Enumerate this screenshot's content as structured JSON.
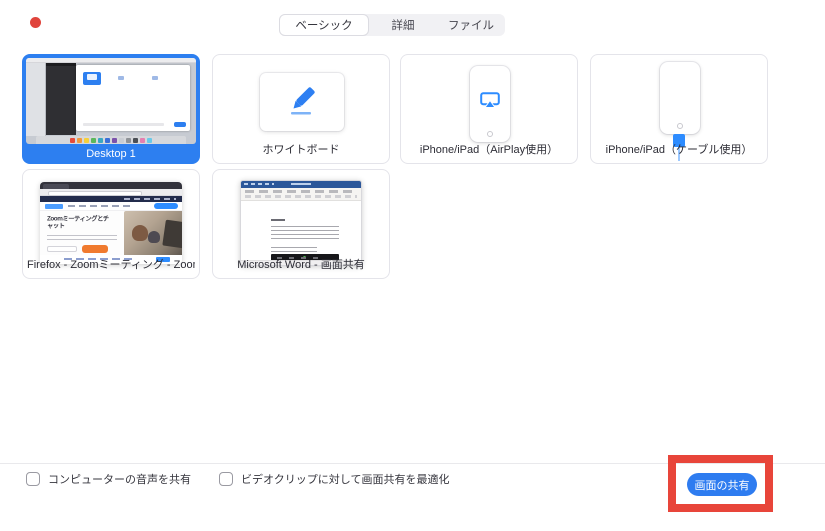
{
  "window": {
    "app": "Zoom 画面共有ウィンドウ"
  },
  "tabs": [
    {
      "label": "ベーシック",
      "selected": true
    },
    {
      "label": "詳細",
      "selected": false
    },
    {
      "label": "ファイル",
      "selected": false
    }
  ],
  "tiles": [
    {
      "label": "Desktop 1",
      "type": "desktop-screenshot",
      "selected": true
    },
    {
      "label": "ホワイトボード",
      "type": "whiteboard",
      "selected": false
    },
    {
      "label": "iPhone/iPad（AirPlay使用）",
      "type": "iphone-airplay",
      "selected": false
    },
    {
      "label": "iPhone/iPad（ケーブル使用）",
      "type": "iphone-cable",
      "selected": false
    },
    {
      "label": "Firefox - Zoomミーティング - Zoom...",
      "type": "firefox-window",
      "selected": false
    },
    {
      "label": "Microsoft Word - 画面共有",
      "type": "word-window",
      "selected": false
    }
  ],
  "firefox_thumb": {
    "heading": "Zoomミーティングとチャット"
  },
  "footer": {
    "checkboxes": [
      {
        "label": "コンピューターの音声を共有",
        "checked": false
      },
      {
        "label": "ビデオクリップに対して画面共有を最適化",
        "checked": false
      }
    ],
    "share_button_label": "画面の共有"
  },
  "colors": {
    "accent-blue": "#2d7ff0",
    "button-blue": "#2e7cf0",
    "annotation-red": "#e8453a",
    "tile-border": "#e4e4ea",
    "label-color": "#2c2c35",
    "tab-bg": "#f1f1f4"
  }
}
